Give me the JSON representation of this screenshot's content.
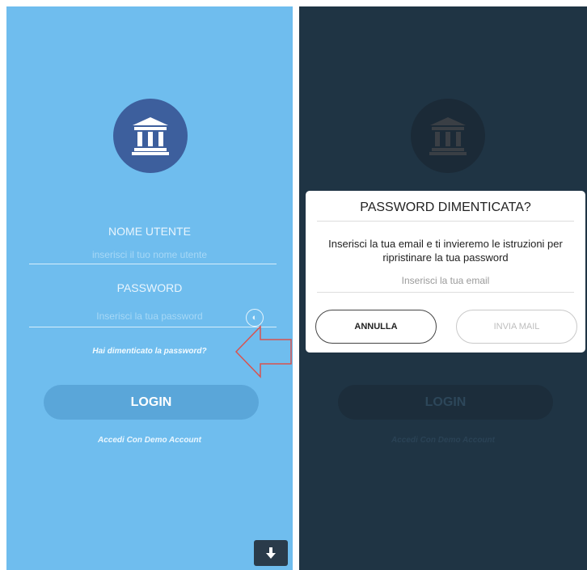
{
  "login_screen": {
    "username_label": "NOME UTENTE",
    "username_placeholder": "inserisci il tuo nome utente",
    "password_label": "PASSWORD",
    "password_placeholder": "Inserisci la tua password",
    "forgot_link": "Hai dimenticato la password?",
    "login_button": "LOGIN",
    "demo_link": "Accedi Con Demo Account",
    "icons": [
      "bank-logo-icon",
      "eye-toggle-icon",
      "download-icon",
      "arrow-pointer-icon"
    ]
  },
  "dialog_screen": {
    "login_button": "LOGIN",
    "demo_link": "Accedi Con Demo Account",
    "modal": {
      "title": "PASSWORD DIMENTICATA?",
      "message": "Inserisci la tua email e ti invieremo le istruzioni per ripristinare la tua password",
      "email_placeholder": "Inserisci la tua email",
      "cancel_button": "ANNULLA",
      "send_button": "INVIA MAIL"
    }
  },
  "colors": {
    "login_bg": "#6fbdee",
    "dialog_bg": "#1f3444",
    "logo_bg": "#3d5f9d",
    "arrow": "#d9534f"
  }
}
